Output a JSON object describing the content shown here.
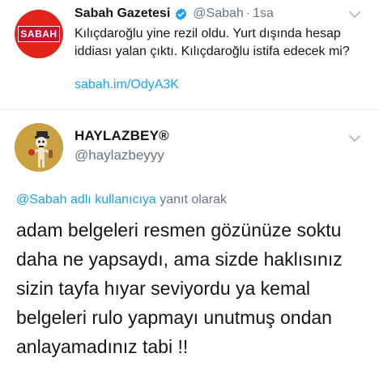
{
  "original_tweet": {
    "avatar_text": "SABAH",
    "display_name": "Sabah Gazetesi",
    "handle": "@Sabah",
    "separator": "·",
    "time": "1sa",
    "text": "Kılıçdaroğlu yine rezil oldu. Yurt dışında hesap iddiası yalan çıktı. Kılıçdaroğlu istifa edecek mi?",
    "link": "sabah.im/OdyA3K"
  },
  "reply_tweet": {
    "display_name": "HAYLAZBEY®",
    "handle": "@haylazbeyyy",
    "replying_mention": "@Sabah adlı kullanıcıya",
    "replying_suffix": "yanıt olarak",
    "lines": [
      "adam belgeleri resmen gözünüze soktu",
      "daha ne yapsaydı, ama sizde haklısınız",
      "sizin tayfa hıyar seviyordu ya kemal",
      "belgeleri rulo yapmayı unutmuş ondan",
      "anlayamadınız tabi !!"
    ]
  },
  "colors": {
    "link": "#1da1f2",
    "secondary_text": "#657786",
    "sabah_red": "#e2231a"
  },
  "icons": [
    "verified-badge-icon",
    "chevron-down-icon"
  ]
}
